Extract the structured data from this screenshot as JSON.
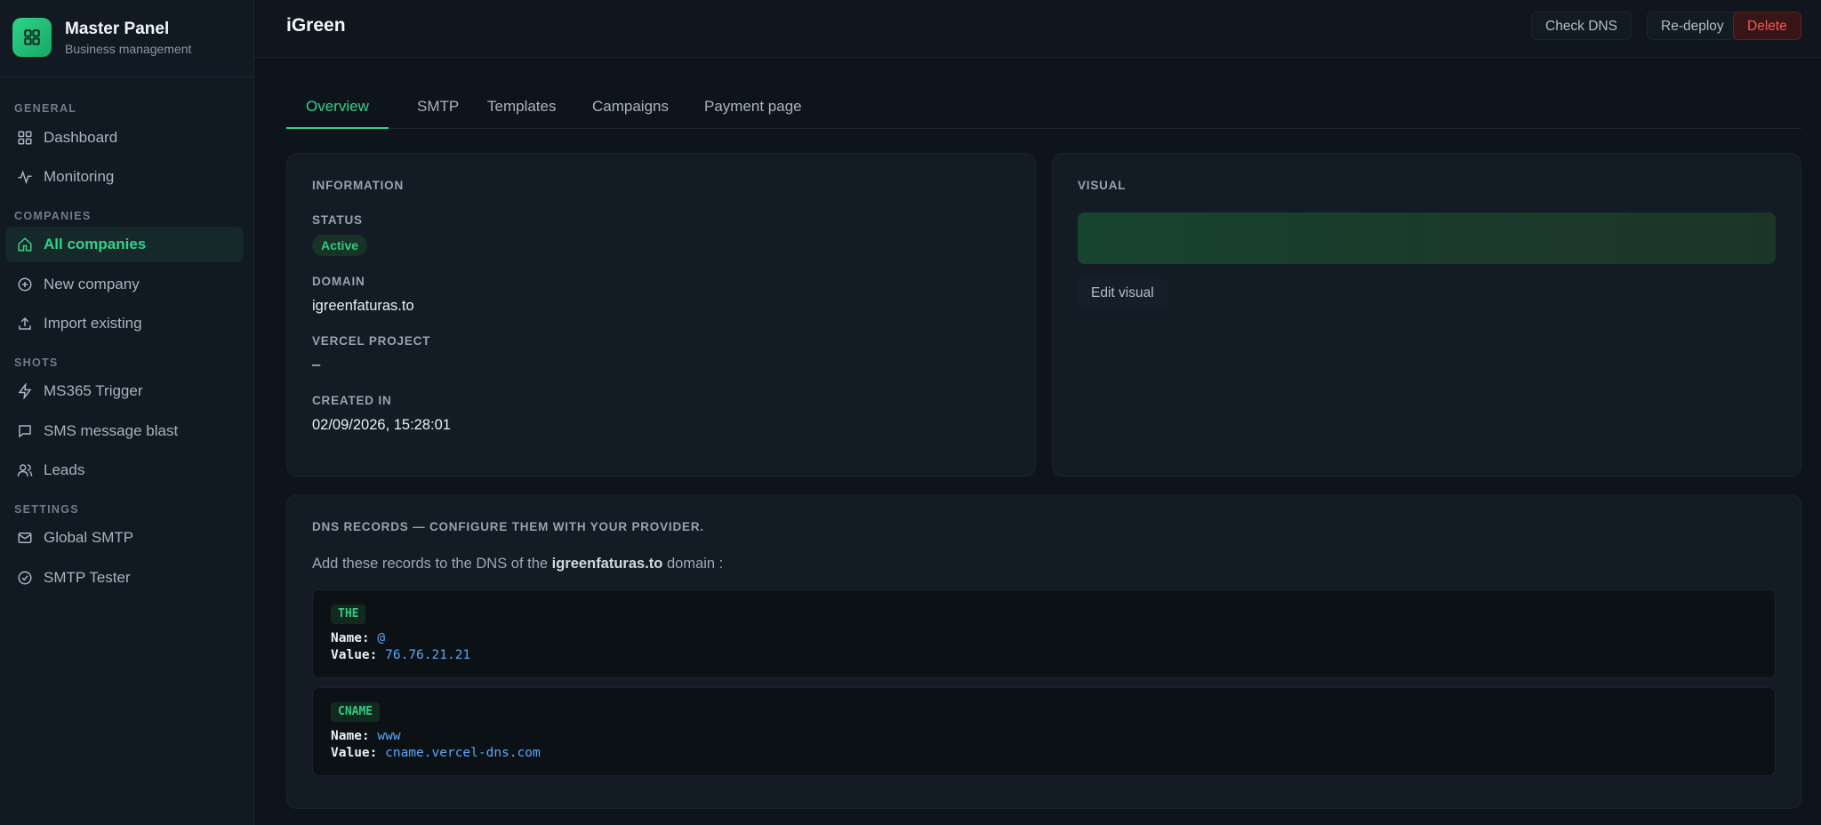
{
  "brand": {
    "title": "Master Panel",
    "subtitle": "Business management"
  },
  "sidebar": {
    "sections": [
      {
        "label": "GENERAL"
      },
      {
        "label": "COMPANIES"
      },
      {
        "label": "SHOTS"
      },
      {
        "label": "SETTINGS"
      }
    ],
    "items": [
      {
        "label": "Dashboard",
        "icon": "grid-icon"
      },
      {
        "label": "Monitoring",
        "icon": "activity-icon"
      },
      {
        "label": "All companies",
        "icon": "home-icon",
        "active": true
      },
      {
        "label": "New company",
        "icon": "plus-circle-icon"
      },
      {
        "label": "Import existing",
        "icon": "upload-icon"
      },
      {
        "label": "MS365 Trigger",
        "icon": "lightning-icon"
      },
      {
        "label": "SMS message blast",
        "icon": "message-icon"
      },
      {
        "label": "Leads",
        "icon": "users-icon"
      },
      {
        "label": "Global SMTP",
        "icon": "mail-icon"
      },
      {
        "label": "SMTP Tester",
        "icon": "check-circle-icon"
      }
    ]
  },
  "header": {
    "title": "iGreen",
    "buttons": {
      "check_dns": "Check DNS",
      "redeploy": "Re-deploy",
      "delete": "Delete"
    }
  },
  "tabs": [
    {
      "label": "Overview",
      "active": true
    },
    {
      "label": "SMTP"
    },
    {
      "label": "Templates"
    },
    {
      "label": "Campaigns"
    },
    {
      "label": "Payment page"
    }
  ],
  "info": {
    "heading": "INFORMATION",
    "status_label": "STATUS",
    "status_value": "Active",
    "domain_label": "DOMAIN",
    "domain_value": "igreenfaturas.to",
    "vercel_label": "VERCEL PROJECT",
    "vercel_value": "–",
    "created_label": "CREATED IN",
    "created_value": "02/09/2026, 15:28:01"
  },
  "visual": {
    "heading": "VISUAL",
    "edit_label": "Edit visual"
  },
  "dns": {
    "heading": "DNS RECORDS — CONFIGURE THEM WITH YOUR PROVIDER.",
    "intro_prefix": "Add these records to the DNS of the",
    "intro_domain": "igreenfaturas.to",
    "intro_suffix": "domain :",
    "name_key": "Name:",
    "value_key": "Value:",
    "records": [
      {
        "type": "THE",
        "name": "@",
        "value": "76.76.21.21"
      },
      {
        "type": "CNAME",
        "name": "www",
        "value": "cname.vercel-dns.com"
      }
    ]
  },
  "colors": {
    "accent": "#30d38b",
    "danger": "#f15b5b",
    "link": "#5aa7f5"
  }
}
